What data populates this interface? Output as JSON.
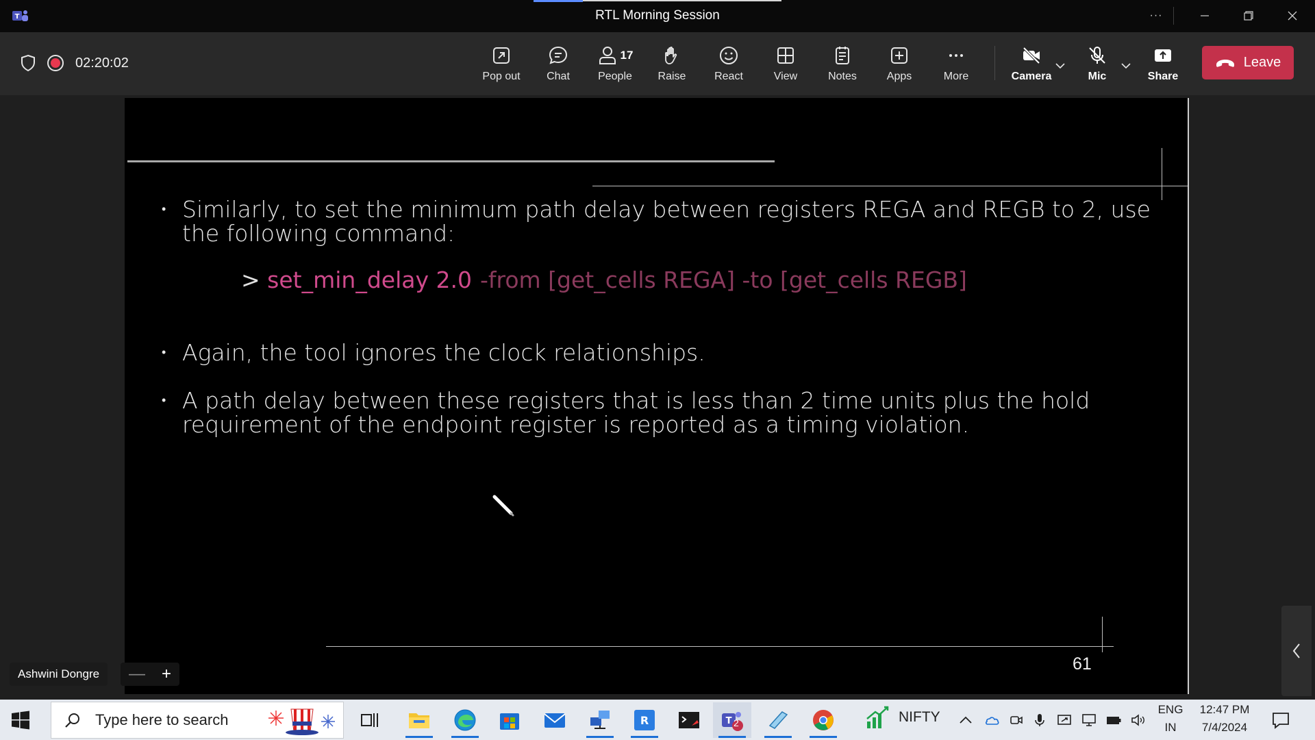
{
  "window": {
    "title": "RTL Morning Session",
    "more_label": "···"
  },
  "meeting": {
    "timer": "02:20:02",
    "tools": {
      "pop_out": "Pop out",
      "chat": "Chat",
      "people": "People",
      "people_count": "17",
      "raise": "Raise",
      "react": "React",
      "view": "View",
      "notes": "Notes",
      "apps": "Apps",
      "more": "More",
      "camera": "Camera",
      "mic": "Mic",
      "share": "Share",
      "leave": "Leave"
    },
    "presenter_name": "Ashwini Dongre",
    "zoom_minus": "—",
    "zoom_plus": "+"
  },
  "slide": {
    "bullet1": "Similarly, to set the minimum path delay between registers REGA and REGB to 2, use the  following command:",
    "command_prompt": ">",
    "command_main": "set_min_delay 2.0",
    "command_rest": "-from [get_cells REGA] -to [get_cells REGB]",
    "bullet2": "Again, the tool ignores the clock relationships.",
    "bullet3": "A path delay between these registers that is less than 2 time units plus the hold requirement of the endpoint register is reported as a timing violation.",
    "bullet_symbol": "•",
    "page_number": "61",
    "colors": {
      "command_main": "#d04a8c",
      "command_rest": "#8a3a5c"
    }
  },
  "taskbar": {
    "search_placeholder": "Type here to search",
    "nifty_label": "NIFTY",
    "teams_badge": "2",
    "language_top": "ENG",
    "language_bottom": "IN",
    "time": "12:47 PM",
    "date": "7/4/2024"
  }
}
